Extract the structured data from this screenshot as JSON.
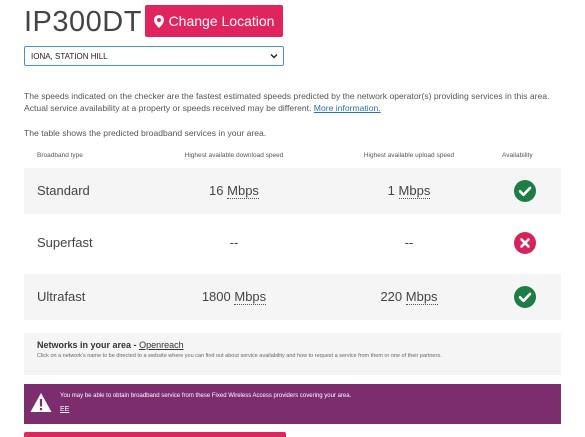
{
  "header": {
    "postcode": "IP300DT",
    "change_location_label": "Change Location"
  },
  "address_select": {
    "value": "IONA, STATION HILL"
  },
  "intro": {
    "text": "The speeds indicated on the checker are the fastest estimated speeds predicted by the network operator(s) providing services in this area. Actual service availability at a property or speeds received may be different.",
    "more_info_link": "More information."
  },
  "table": {
    "intro": "The table shows the predicted broadband services in your area.",
    "headers": {
      "type": "Broadband type",
      "download": "Highest available download speed",
      "upload": "Highest available upload speed",
      "availability": "Availability"
    },
    "rows": [
      {
        "type": "Standard",
        "down_value": "16",
        "down_unit": "Mbps",
        "up_value": "1",
        "up_unit": "Mbps",
        "available": "check-circle-icon"
      },
      {
        "type": "Superfast",
        "down_value": "--",
        "down_unit": "",
        "up_value": "--",
        "up_unit": "",
        "available": "cross-circle-icon"
      },
      {
        "type": "Ultrafast",
        "down_value": "1800",
        "down_unit": "Mbps",
        "up_value": "220",
        "up_unit": "Mbps",
        "available": "check-circle-icon"
      }
    ]
  },
  "networks": {
    "title": "Networks in your area -",
    "link": "Openreach",
    "subtext": "Click on a network's name to be directed to a website where you can find out about service availability and how to request a service from them or one of their partners."
  },
  "fwa": {
    "message": "You may be able to obtain broadband service from these Fixed Wireless Access providers covering your area.",
    "provider": "EE"
  },
  "colors": {
    "accent": "#e0245e",
    "available": "#1e7d45",
    "unavailable": "#d6245b",
    "fwa_banner": "#7b2d6e"
  }
}
